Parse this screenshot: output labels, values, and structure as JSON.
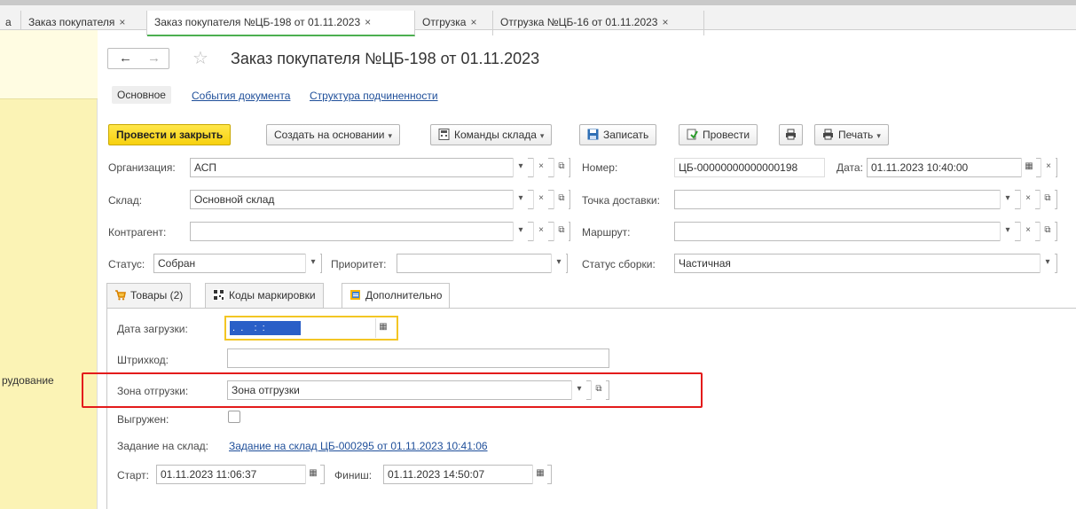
{
  "tabs": [
    {
      "label": "а",
      "active": false
    },
    {
      "label": "Заказ покупателя",
      "active": false
    },
    {
      "label": "Заказ покупателя №ЦБ-198 от 01.11.2023",
      "active": true
    },
    {
      "label": "Отгрузка",
      "active": false
    },
    {
      "label": "Отгрузка №ЦБ-16 от 01.11.2023",
      "active": false
    }
  ],
  "tab_close_glyph": "×",
  "left_pane": {
    "item": "рудование"
  },
  "header": {
    "back_glyph": "←",
    "forward_glyph": "→",
    "star_glyph": "☆",
    "title": "Заказ покупателя №ЦБ-198 от 01.11.2023"
  },
  "subtabs": {
    "main": "Основное",
    "events": "События документа",
    "structure": "Структура подчиненности"
  },
  "toolbar": {
    "post_close": "Провести и закрыть",
    "create_based": "Создать на основании",
    "warehouse_cmds": "Команды склада",
    "save": "Записать",
    "post": "Провести",
    "print": "Печать"
  },
  "form": {
    "org_label": "Организация:",
    "org_value": "АСП",
    "number_label": "Номер:",
    "number_value": "ЦБ-00000000000000198",
    "date_label": "Дата:",
    "date_value": "01.11.2023 10:40:00",
    "warehouse_label": "Склад:",
    "warehouse_value": "Основной склад",
    "delivery_point_label": "Точка доставки:",
    "delivery_point_value": "",
    "counterparty_label": "Контрагент:",
    "counterparty_value": "",
    "route_label": "Маршрут:",
    "route_value": "",
    "status_label": "Статус:",
    "status_value": "Собран",
    "priority_label": "Приоритет:",
    "priority_value": "",
    "assembly_status_label": "Статус сборки:",
    "assembly_status_value": "Частичная"
  },
  "inner_tabs": {
    "goods": "Товары (2)",
    "marking": "Коды маркировки",
    "extra": "Дополнительно"
  },
  "extra": {
    "load_date_label": "Дата загрузки:",
    "load_date_value": " .  .    :  :",
    "barcode_label": "Штрихкод:",
    "barcode_value": "",
    "zone_label": "Зона отгрузки:",
    "zone_value": "Зона отгрузки",
    "unloaded_label": "Выгружен:",
    "task_label": "Задание на склад:",
    "task_link": "Задание на склад ЦБ-000295 от 01.11.2023 10:41:06",
    "start_label": "Старт:",
    "start_value": "01.11.2023 11:06:37",
    "finish_label": "Финиш:",
    "finish_value": "01.11.2023 14:50:07"
  },
  "colors": {
    "primary_button": "#f7d10e",
    "highlight_box": "#e31b1b",
    "link": "#1f4f9a",
    "left_pane": "#fbf3b5"
  }
}
